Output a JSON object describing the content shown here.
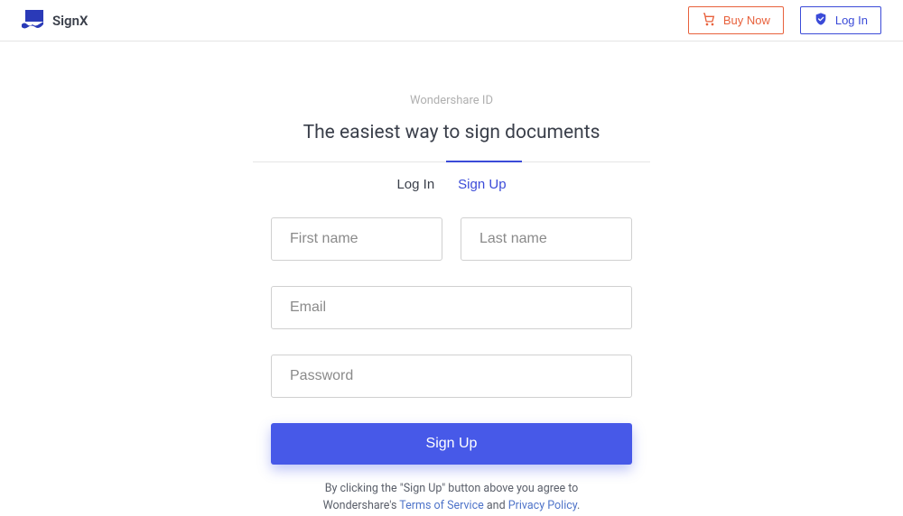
{
  "header": {
    "brand": "SignX",
    "buy_now": "Buy Now",
    "log_in": "Log In"
  },
  "main": {
    "subheading": "Wondershare ID",
    "heading": "The easiest way to sign documents",
    "tabs": {
      "login": "Log In",
      "signup": "Sign Up"
    },
    "fields": {
      "first_name_placeholder": "First name",
      "last_name_placeholder": "Last name",
      "email_placeholder": "Email",
      "password_placeholder": "Password"
    },
    "submit": "Sign Up",
    "legal": {
      "line1_prefix": "By clicking the \"Sign Up\" button above you agree to",
      "line2_prefix": "Wondershare's ",
      "tos": "Terms of Service",
      "and": " and ",
      "privacy": "Privacy Policy",
      "period": "."
    }
  }
}
